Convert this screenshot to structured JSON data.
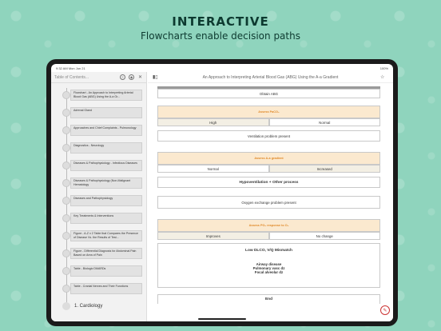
{
  "promo": {
    "headline": "INTERACTIVE",
    "subline": "Flowcharts enable decision paths"
  },
  "status": {
    "time": "9:32 AM",
    "date": "Mon Jun 21",
    "battery": "100%"
  },
  "sidebar": {
    "placeholder": "Table of Contents...",
    "items": [
      "Flowchart - An Approach to Interpreting Arterial Blood Gas (ABG) Using the A-a Gr...",
      "Adrenal Gland",
      "Approaches and Chief Complaints - Pulmonology",
      "Diagnostics - Neurology",
      "Diseases & Pathophysiology - Infectious Diseases",
      "Diseases & Pathophysiology (Non-Malignant Hematology",
      "Diseases and Pathophysiology",
      "Key Treatments & Interventions",
      "Figure - A-Z x 2 Table that Compares the Presence of Disease Vs. the Results of Test...",
      "Figure - Differential Diagnosis for Abdominal Pain Based on Area of Pain",
      "Table - Biologic DMARDs",
      "Table - Cranial Nerves and Their Functions"
    ],
    "bottom_label": "1. Cardiology"
  },
  "toolbar": {
    "doc_title": "An Approach to Interpreting Arterial Blood Gas (ABG) Using the A-a Gradient"
  },
  "flow": {
    "obtain": "Obtain ABG",
    "assess_paco2": "Assess PaCO₂",
    "high": "High",
    "normal": "Normal",
    "vent_problem": "Ventilation problem present",
    "assess_aa": "Assess A-a gradient",
    "normal2": "Normal",
    "increased": "Increased",
    "hypovent": "Hypoventilation + Other process",
    "oxygen_exchange": "Oxygen exchange problem present",
    "assess_po2": "Assess PO₂ response to O₂",
    "improves": "Improves",
    "no_change": "No change",
    "low_dlco": "Low DLCO, V/Q Mismatch",
    "airway": "Airway disease",
    "pulm_vasc": "Pulmonary vasc dz",
    "focal_alv": "Focal alveolar dz",
    "end": "End"
  }
}
